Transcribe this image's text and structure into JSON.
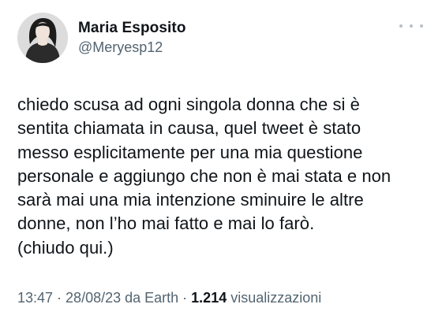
{
  "author": {
    "name": "Maria Esposito",
    "handle": "@Meryesp12",
    "avatar_icon": "profile-photo"
  },
  "more_icon": "more-options-icon",
  "tweet": {
    "text": "chiedo scusa ad ogni singola donna che si è\nsentita chiamata in causa, quel tweet è stato\nmesso esplicitamente per una mia questione\npersonale e aggiungo che non è mai stata e non\nsarà mai una mia intenzione sminuire le altre\ndonne, non l’ho mai fatto e mai lo farò.\n(chiudo qui.)"
  },
  "meta": {
    "time": "13:47",
    "separator1": " · ",
    "date": "28/08/23",
    "source": " da Earth",
    "separator2": " · ",
    "views_count": "1.214",
    "views_label": " visualizzazioni"
  },
  "colors": {
    "text": "#0f1419",
    "secondary": "#536471",
    "background": "#ffffff"
  }
}
